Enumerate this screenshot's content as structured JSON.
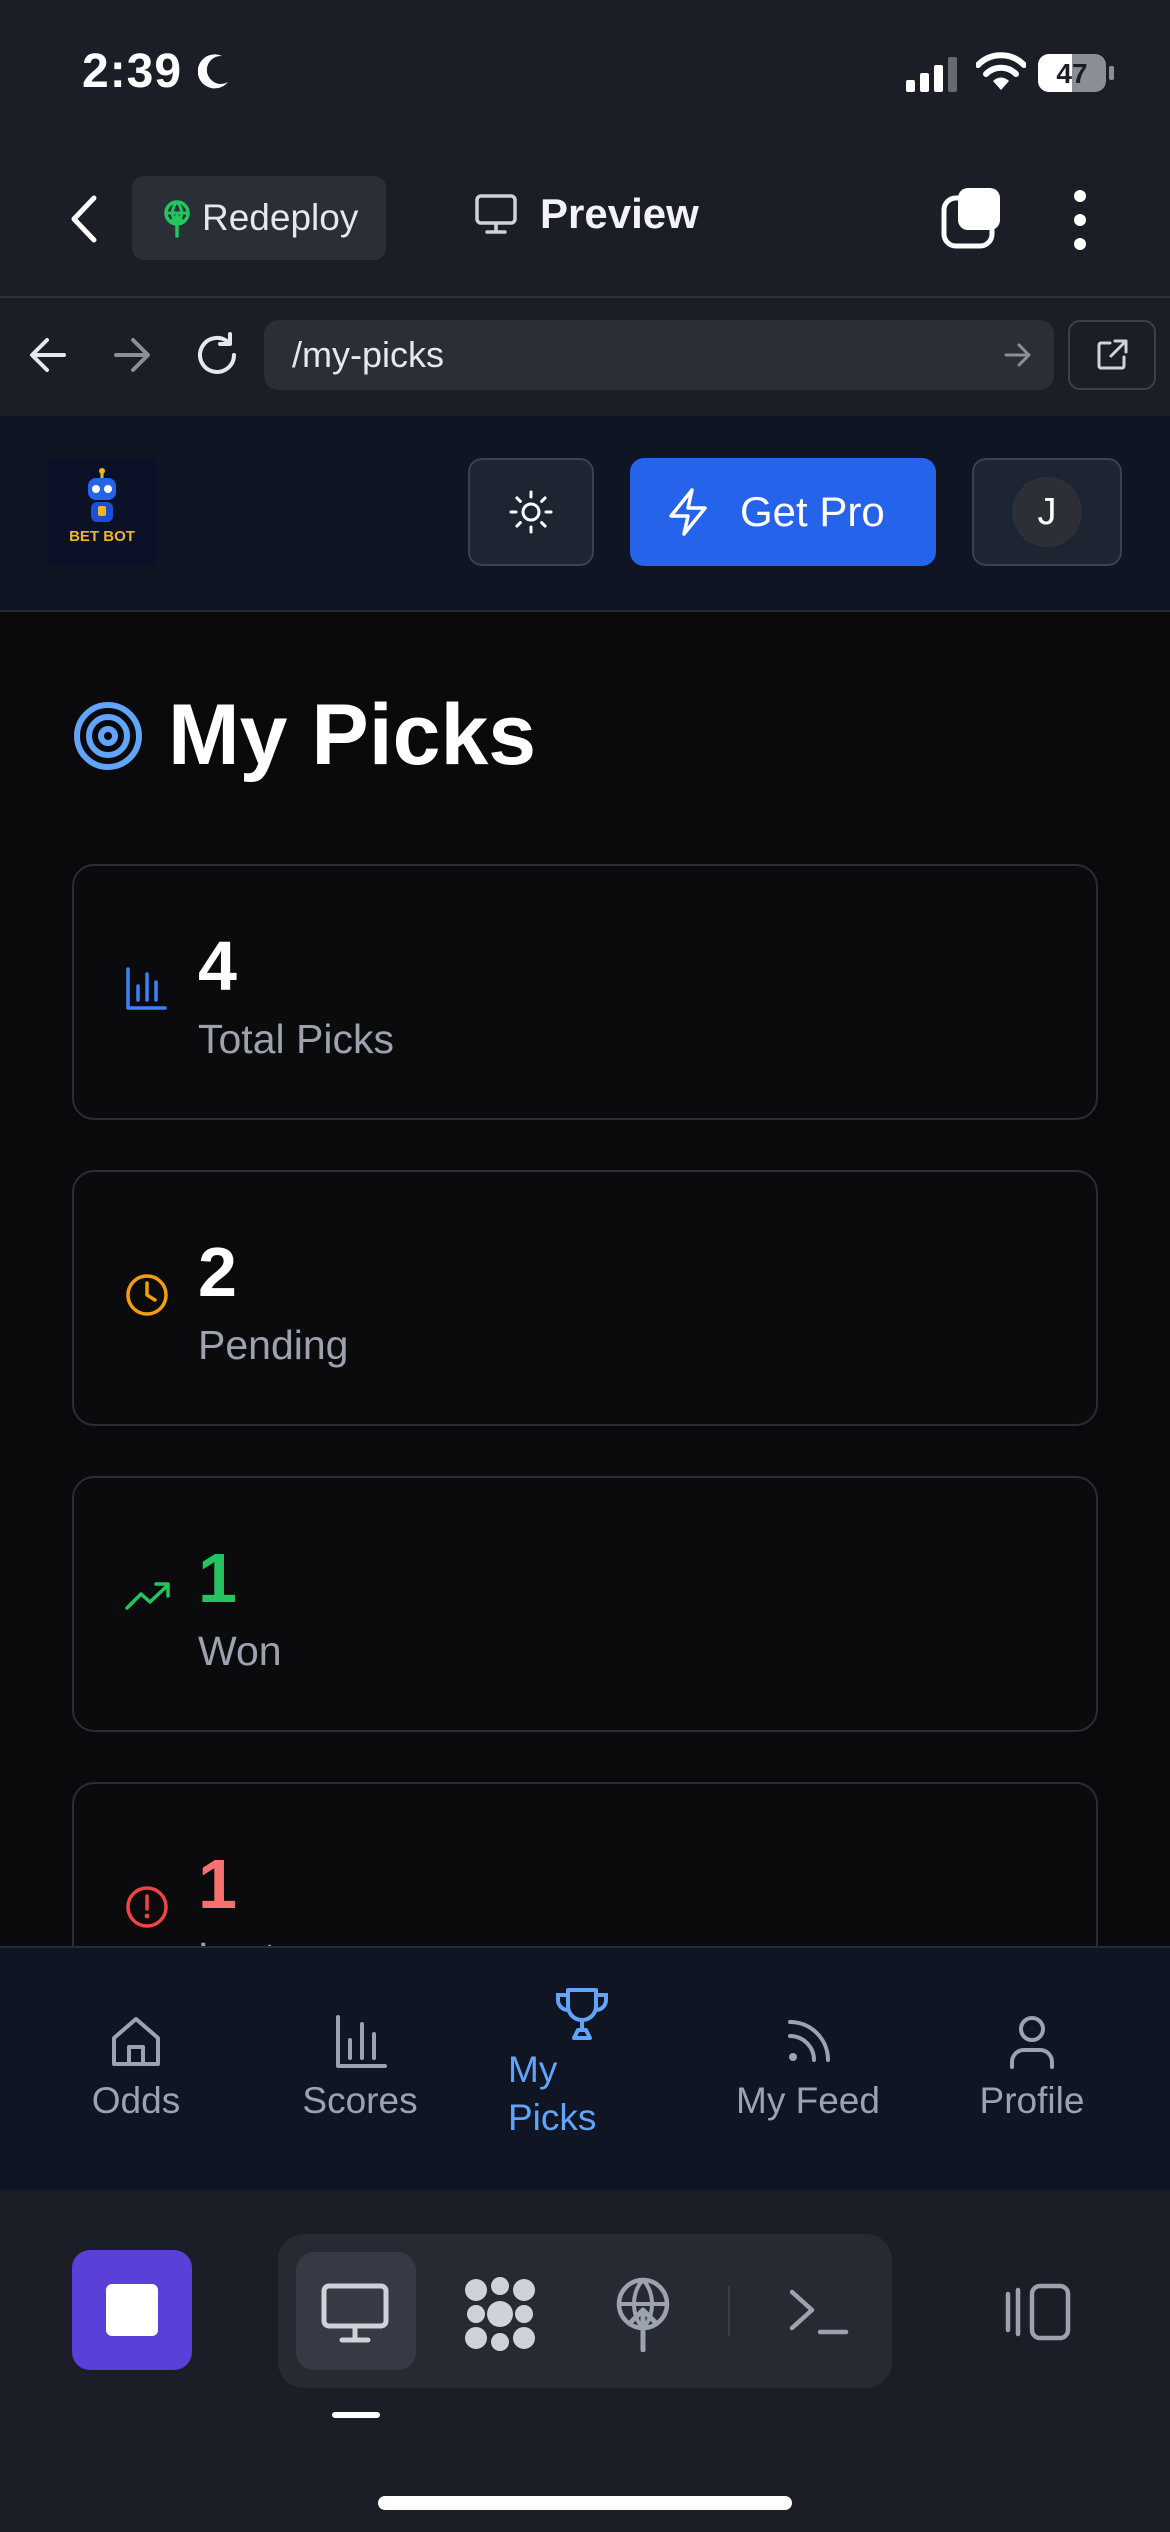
{
  "status_bar": {
    "time": "2:39",
    "battery": "47"
  },
  "top_bar": {
    "redeploy_label": "Redeploy",
    "preview_label": "Preview"
  },
  "url_bar": {
    "path": "/my-picks"
  },
  "app_header": {
    "logo_text": "BET BOT",
    "get_pro_label": "Get Pro",
    "avatar_initial": "J"
  },
  "page": {
    "title": "My Picks"
  },
  "stats": [
    {
      "value": "4",
      "label": "Total Picks",
      "color": "#ffffff",
      "icon": "bar-chart-icon",
      "icon_color": "#3b82f6"
    },
    {
      "value": "2",
      "label": "Pending",
      "color": "#ffffff",
      "icon": "clock-icon",
      "icon_color": "#f59e0b"
    },
    {
      "value": "1",
      "label": "Won",
      "color": "#22c55e",
      "icon": "trending-up-icon",
      "icon_color": "#22c55e"
    },
    {
      "value": "1",
      "label": "Lost",
      "color": "#f87171",
      "icon": "alert-circle-icon",
      "icon_color": "#ef4444"
    }
  ],
  "bottom_nav": {
    "items": [
      {
        "label": "Odds",
        "icon": "home-icon",
        "active": false
      },
      {
        "label": "Scores",
        "icon": "bar-chart-icon",
        "active": false
      },
      {
        "label": "My Picks",
        "icon": "trophy-icon",
        "active": true
      },
      {
        "label": "My Feed",
        "icon": "rss-icon",
        "active": false
      },
      {
        "label": "Profile",
        "icon": "user-icon",
        "active": false
      }
    ]
  },
  "colors": {
    "accent": "#2563eb",
    "active_nav": "#60a5fa",
    "stop": "#5b3fd9"
  }
}
